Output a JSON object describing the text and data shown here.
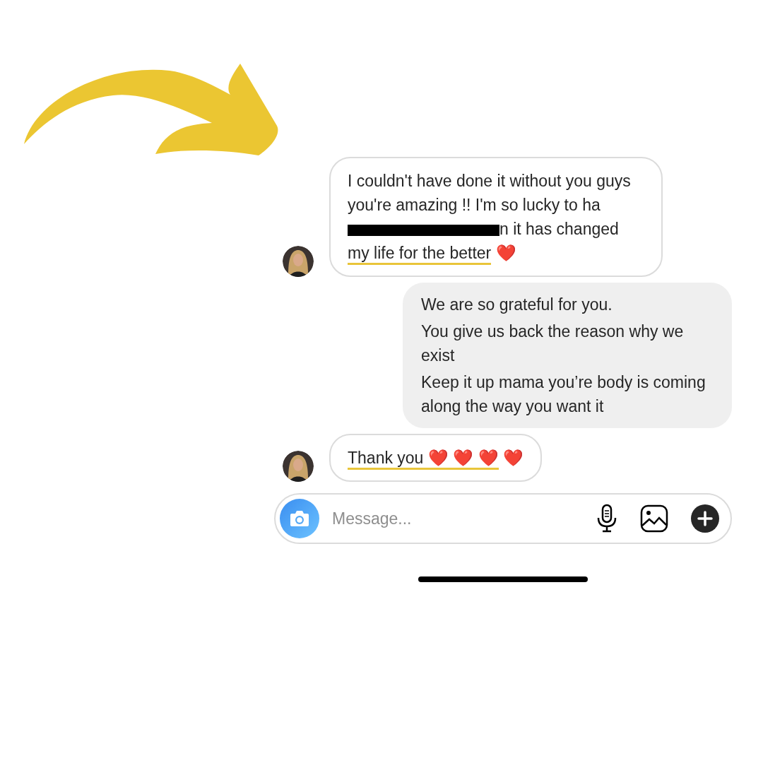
{
  "messages": [
    {
      "kind": "incoming",
      "avatar": {
        "kind": "picture"
      },
      "parts": [
        {
          "kind": "text",
          "text": "I couldn't have done it without you guys you're amazing !! I'm so lucky to ha"
        },
        {
          "kind": "redacted"
        },
        {
          "kind": "text",
          "text": "n it has changed "
        },
        {
          "kind": "underlined",
          "text": "my life for the better"
        },
        {
          "kind": "text",
          "text": " ❤️"
        }
      ]
    },
    {
      "kind": "outgoing",
      "lines": [
        "We are so grateful for you.",
        "You give us back the reason why we exist",
        "Keep it up mama you’re body is coming along the way you want it"
      ]
    },
    {
      "kind": "incoming",
      "avatar": {
        "kind": "picture"
      },
      "parts": [
        {
          "kind": "underlined",
          "text": "Thank you ❤️ ❤️ ❤️"
        },
        {
          "kind": "text",
          "text": " ❤️"
        }
      ]
    }
  ],
  "composer": {
    "placeholder": "Message..."
  }
}
